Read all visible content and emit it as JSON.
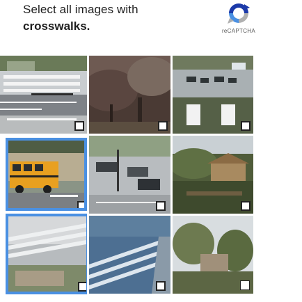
{
  "instruction": {
    "line1": "Select all images with",
    "line2": "crosswalks."
  },
  "brand": {
    "text": "reCAPTCHA",
    "icon": "recaptcha-logo-icon",
    "colors": {
      "blue": "#1c3aa9",
      "light_blue": "#4a90e2",
      "gray": "#b0b0b0"
    }
  },
  "grid": {
    "rows": 3,
    "cols": 3,
    "selection_color": "#4a90e2",
    "tiles": [
      {
        "row": 0,
        "col": 0,
        "scene": "crosswalk-street",
        "selected": false
      },
      {
        "row": 0,
        "col": 1,
        "scene": "trees",
        "selected": false
      },
      {
        "row": 0,
        "col": 2,
        "scene": "highway-cars",
        "selected": false
      },
      {
        "row": 1,
        "col": 0,
        "scene": "school-bus",
        "selected": true
      },
      {
        "row": 1,
        "col": 1,
        "scene": "street-cars",
        "selected": false
      },
      {
        "row": 1,
        "col": 2,
        "scene": "houses-trees",
        "selected": false
      },
      {
        "row": 2,
        "col": 0,
        "scene": "crosswalk-stripes",
        "selected": true
      },
      {
        "row": 2,
        "col": 1,
        "scene": "crosswalk-lines",
        "selected": false
      },
      {
        "row": 2,
        "col": 2,
        "scene": "trees-houses",
        "selected": false
      }
    ]
  }
}
